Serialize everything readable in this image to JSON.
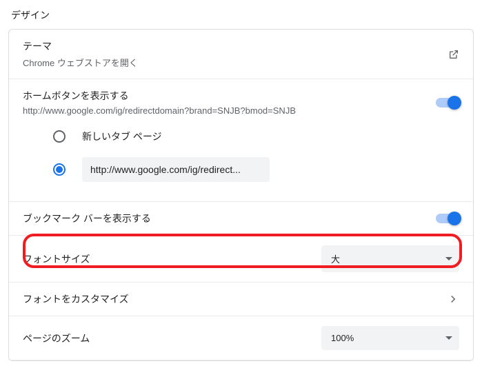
{
  "page_title": "デザイン",
  "theme": {
    "title": "テーマ",
    "subtitle": "Chrome ウェブストアを開く"
  },
  "home_button": {
    "title": "ホームボタンを表示する",
    "url": "http://www.google.com/ig/redirectdomain?brand=SNJB?bmod=SNJB",
    "toggle": true,
    "radios": {
      "new_tab": {
        "label": "新しいタブ ページ",
        "checked": false
      },
      "custom": {
        "value": "http://www.google.com/ig/redirect...",
        "checked": true
      }
    }
  },
  "bookmark_bar": {
    "title": "ブックマーク バーを表示する",
    "toggle": true
  },
  "font_size": {
    "label": "フォントサイズ",
    "value": "大"
  },
  "font_customize": {
    "label": "フォントをカスタマイズ"
  },
  "page_zoom": {
    "label": "ページのズーム",
    "value": "100%"
  }
}
